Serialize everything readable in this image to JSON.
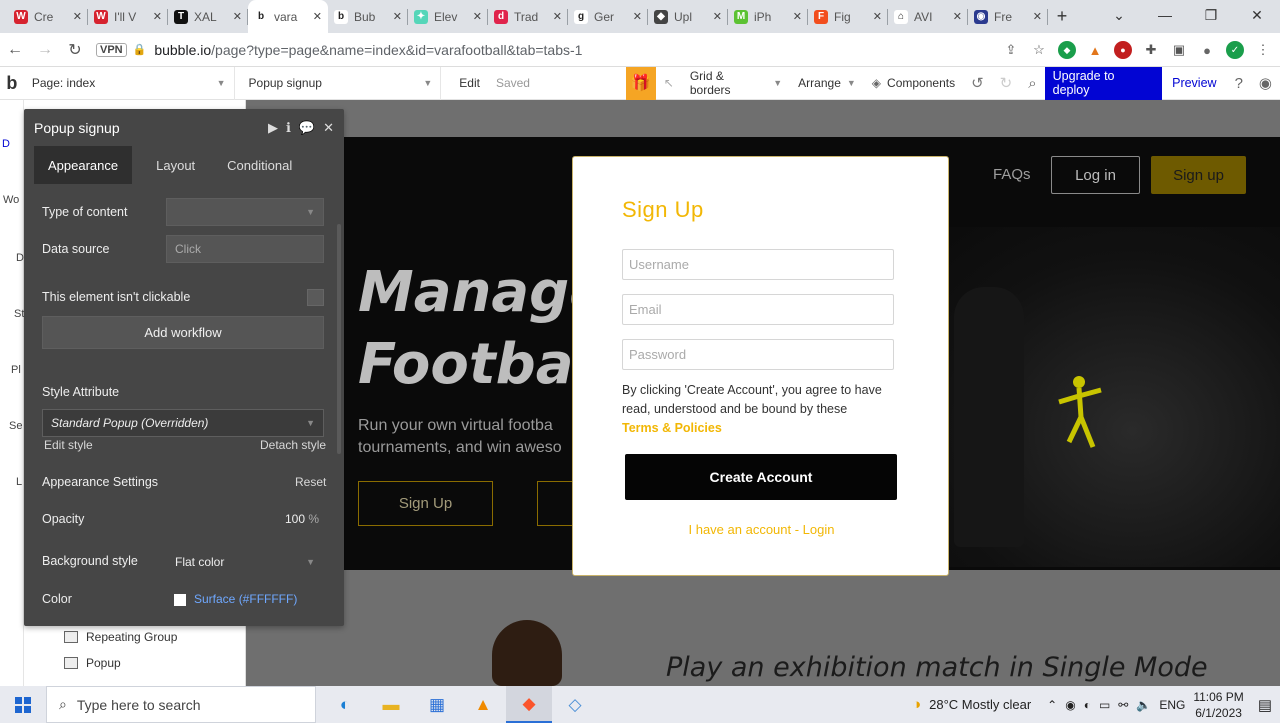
{
  "browser": {
    "tabs": [
      {
        "title": "Cre",
        "fav_color": "#d6232f",
        "fav_glyph": "W",
        "active": false
      },
      {
        "title": "I'll V",
        "fav_color": "#d6232f",
        "fav_glyph": "W",
        "active": false
      },
      {
        "title": "XAL",
        "fav_color": "#111111",
        "fav_glyph": "T",
        "active": false
      },
      {
        "title": "vara",
        "fav_color": "#ffffff",
        "fav_glyph": "b",
        "active": true
      },
      {
        "title": "Bub",
        "fav_color": "#ffffff",
        "fav_glyph": "b",
        "active": false
      },
      {
        "title": "Elev",
        "fav_color": "#55d6b9",
        "fav_glyph": "✦",
        "active": false
      },
      {
        "title": "Trad",
        "fav_color": "#e0244c",
        "fav_glyph": "d",
        "active": false
      },
      {
        "title": "Ger",
        "fav_color": "#ffffff",
        "fav_glyph": "g",
        "active": false
      },
      {
        "title": "Upl",
        "fav_color": "#444444",
        "fav_glyph": "◆",
        "active": false
      },
      {
        "title": "iPh",
        "fav_color": "#5cc233",
        "fav_glyph": "M",
        "active": false
      },
      {
        "title": "Fig",
        "fav_color": "#f24e1e",
        "fav_glyph": "F",
        "active": false
      },
      {
        "title": "AVI",
        "fav_color": "#ffffff",
        "fav_glyph": "⌂",
        "active": false
      },
      {
        "title": "Fre",
        "fav_color": "#2b3a8f",
        "fav_glyph": "◉",
        "active": false
      }
    ],
    "url_host": "bubble.io",
    "url_path": "/page?type=page&name=index&id=varafootball&tab=tabs-1",
    "vpn": "VPN"
  },
  "bubble_toolbar": {
    "page_label": "Page: index",
    "element_select": "Popup signup",
    "edit": "Edit",
    "saved": "Saved",
    "grid": "Grid & borders",
    "arrange": "Arrange",
    "components": "Components",
    "upgrade": "Upgrade to deploy",
    "preview": "Preview"
  },
  "leftnav": [
    "D",
    "Wo",
    "D",
    "St",
    "Pl",
    "Se",
    "L"
  ],
  "tree": {
    "repeating_group": "Repeating Group",
    "popup": "Popup"
  },
  "editor": {
    "title": "Popup signup",
    "tabs": [
      "Appearance",
      "Layout",
      "Conditional"
    ],
    "type_of_content": "Type of content",
    "data_source": "Data source",
    "data_source_placeholder": "Click",
    "not_clickable": "This element isn't clickable",
    "add_workflow": "Add workflow",
    "style_attribute": "Style Attribute",
    "style_value": "Standard Popup (Overridden)",
    "edit_style": "Edit style",
    "detach_style": "Detach style",
    "appearance_settings": "Appearance Settings",
    "reset": "Reset",
    "opacity_label": "Opacity",
    "opacity_value": "100",
    "opacity_unit": "%",
    "background_style": "Background style",
    "background_value": "Flat color",
    "color_label": "Color",
    "color_value": "Surface (#FFFFFF)"
  },
  "page": {
    "faqs": "FAQs",
    "login": "Log in",
    "signup": "Sign up",
    "hero_title": "Manage\nFootball",
    "hero_sub_1": "Run your own virtual footba",
    "hero_sub_2": "tournaments, and win aweso",
    "hero_signup": "Sign Up",
    "exhibition": "Play an exhibition match in Single Mode"
  },
  "popup": {
    "title": "Sign Up",
    "username_placeholder": "Username",
    "email_placeholder": "Email",
    "password_placeholder": "Password",
    "terms_text": "By clicking 'Create Account', you agree to have read, understood and be bound by these",
    "terms_link": "Terms & Policies",
    "create_account": "Create Account",
    "have_account": "I have an account - Login"
  },
  "taskbar": {
    "search_placeholder": "Type here to search",
    "weather": "28°C  Mostly clear",
    "lang": "ENG",
    "time": "11:06 PM",
    "date": "6/1/2023"
  }
}
